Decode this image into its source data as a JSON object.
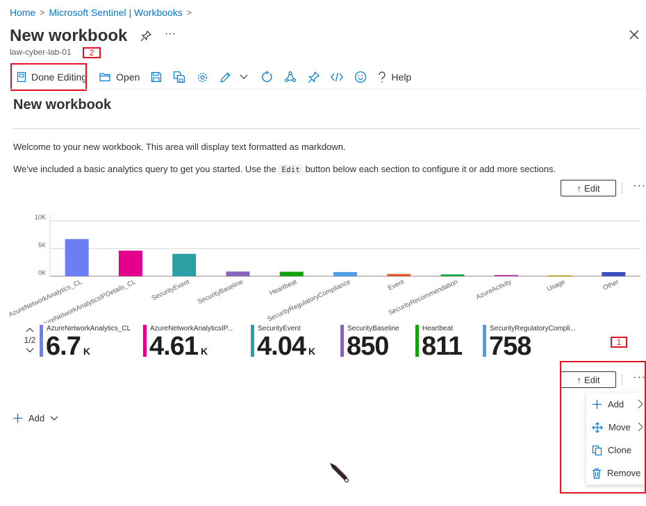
{
  "breadcrumb": {
    "home": "Home",
    "sentinel": "Microsoft Sentinel | Workbooks"
  },
  "header": {
    "title": "New workbook",
    "subtitle": "law-cyber-lab-01",
    "more": "···"
  },
  "annotations": {
    "badge_2": "2",
    "badge_1": "1"
  },
  "toolbar": {
    "done_editing": "Done Editing",
    "open": "Open",
    "help": "Help",
    "icons": [
      "save-icon",
      "save-as-icon",
      "settings-icon",
      "edit-icon",
      "chevron-down-icon",
      "refresh-icon",
      "share-icon",
      "pin-icon",
      "code-icon",
      "feedback-icon",
      "help-icon"
    ]
  },
  "workbook": {
    "title": "New workbook",
    "intro": "Welcome to your new workbook. This area will display text formatted as markdown.",
    "line2_pre": "We've included a basic analytics query to get you started. Use the ",
    "line2_code": "Edit",
    "line2_post": " button below each section to configure it or add more sections.",
    "edit_label": "Edit",
    "edit_arrow": "↑",
    "more": "···"
  },
  "chart_data": {
    "type": "bar",
    "categories": [
      "AzureNetworkAnalytics_CL",
      "AzureNetworkAnalyticsIPDetails_CL",
      "SecurityEvent",
      "SecurityBaseline",
      "Heartbeat",
      "SecurityRegulatoryCompliance",
      "Event",
      "SecurityRecommendation",
      "AzureActivity",
      "Usage",
      "Other"
    ],
    "values": [
      6700,
      4610,
      4040,
      850,
      811,
      758,
      410,
      330,
      230,
      160,
      750
    ],
    "colors": [
      "#6b7ff2",
      "#e3008c",
      "#2aa0a4",
      "#8764b8",
      "#13a10e",
      "#4f9ee6",
      "#e05a2c",
      "#16a34a",
      "#c239b3",
      "#b8a000",
      "#3a4fc4"
    ],
    "yticks": [
      "0K",
      "5K",
      "10K"
    ],
    "ylim": [
      0,
      11000
    ],
    "grid": true
  },
  "tiles": {
    "pager": "1/2",
    "items": [
      {
        "label": "AzureNetworkAnalytics_CL",
        "value": "6.7",
        "unit": "K",
        "color": "#6b7ff2"
      },
      {
        "label": "AzureNetworkAnalyticsIP...",
        "value": "4.61",
        "unit": "K",
        "color": "#e3008c"
      },
      {
        "label": "SecurityEvent",
        "value": "4.04",
        "unit": "K",
        "color": "#2aa0a4"
      },
      {
        "label": "SecurityBaseline",
        "value": "850",
        "unit": "",
        "color": "#8764b8"
      },
      {
        "label": "Heartbeat",
        "value": "811",
        "unit": "",
        "color": "#13a10e"
      },
      {
        "label": "SecurityRegulatoryCompli...",
        "value": "758",
        "unit": "",
        "color": "#4f9ee6"
      }
    ]
  },
  "add": {
    "label": "Add"
  },
  "context_menu": {
    "items": [
      {
        "label": "Add",
        "icon": "plus-icon"
      },
      {
        "label": "Move",
        "icon": "move-icon"
      },
      {
        "label": "Clone",
        "icon": "clone-icon"
      },
      {
        "label": "Remove",
        "icon": "trash-icon"
      }
    ]
  },
  "colors": {
    "accent": "#0078d4",
    "annotation": "#e81123"
  }
}
